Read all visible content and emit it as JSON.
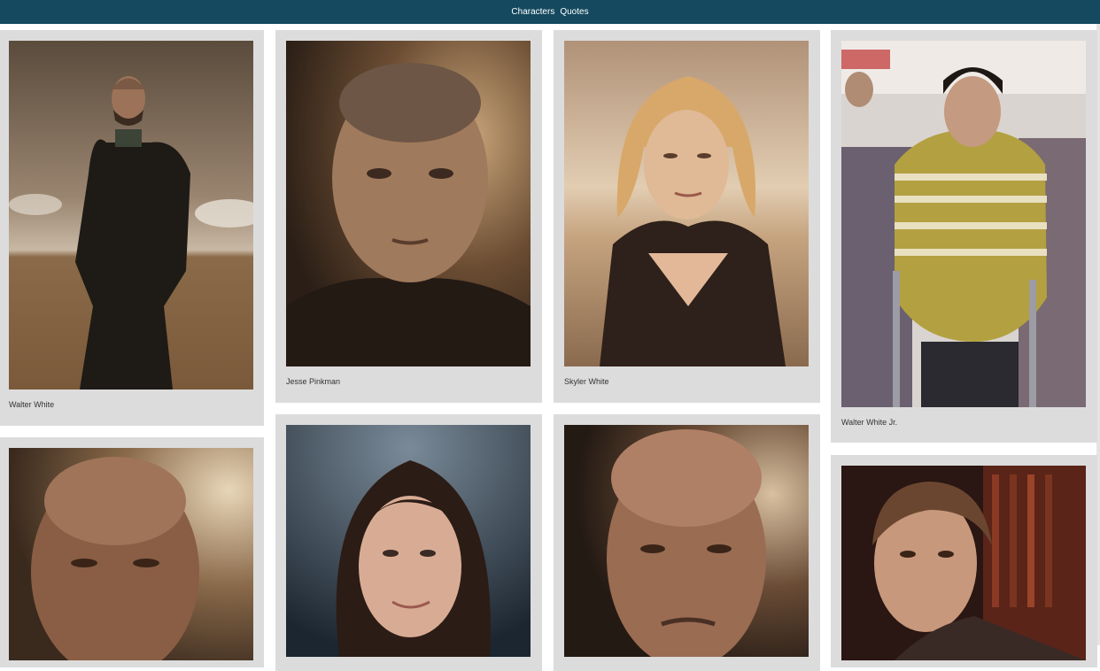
{
  "nav": {
    "items": [
      "Characters",
      "Quotes"
    ]
  },
  "colors": {
    "topbar": "#14495f",
    "card": "#dcdcdc"
  },
  "characters": [
    {
      "name": "Walter White"
    },
    {
      "name": "Jesse Pinkman"
    },
    {
      "name": "Skyler White"
    },
    {
      "name": "Walter White Jr."
    },
    {
      "name": ""
    },
    {
      "name": ""
    },
    {
      "name": ""
    },
    {
      "name": ""
    }
  ]
}
